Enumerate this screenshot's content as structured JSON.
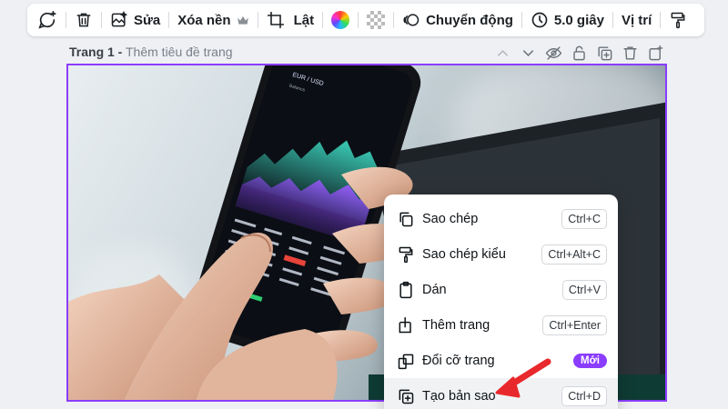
{
  "toolbar": {
    "edit_label": "Sửa",
    "remove_bg_label": "Xóa nền",
    "flip_label": "Lật",
    "animate_label": "Chuyển động",
    "duration_label": "5.0 giây",
    "position_label": "Vị trí"
  },
  "page": {
    "number_label": "Trang 1 -",
    "title_placeholder": "Thêm tiêu đề trang"
  },
  "context_menu": {
    "items": [
      {
        "label": "Sao chép",
        "shortcut": "Ctrl+C",
        "icon": "copy-icon"
      },
      {
        "label": "Sao chép kiểu",
        "shortcut": "Ctrl+Alt+C",
        "icon": "paint-roller-icon"
      },
      {
        "label": "Dán",
        "shortcut": "Ctrl+V",
        "icon": "clipboard-icon"
      },
      {
        "label": "Thêm trang",
        "shortcut": "Ctrl+Enter",
        "icon": "add-page-icon"
      },
      {
        "label": "Đổi cỡ trang",
        "badge": "Mới",
        "icon": "resize-icon"
      },
      {
        "label": "Tạo bản sao",
        "shortcut": "Ctrl+D",
        "icon": "duplicate-icon"
      }
    ]
  },
  "phone_screen": {
    "pair": "EUR / USD",
    "balance": "Balance"
  },
  "colors": {
    "accent": "#8b3dff",
    "arrow": "#e8282c"
  }
}
